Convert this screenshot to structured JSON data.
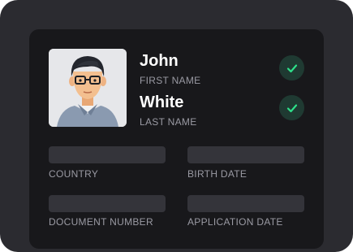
{
  "profile": {
    "first_name": "John",
    "first_name_label": "FIRST NAME",
    "last_name": "White",
    "last_name_label": "LAST NAME",
    "first_name_verified": true,
    "last_name_verified": true
  },
  "fields": {
    "country_label": "COUNTRY",
    "birth_date_label": "BIRTH DATE",
    "document_number_label": "DOCUMENT NUMBER",
    "application_date_label": "APPLICATION DATE"
  },
  "colors": {
    "card": "#18181b",
    "frame": "#2b2b30",
    "check_accent": "#2ee08a",
    "placeholder": "#34343a"
  },
  "icons": {
    "verified": "check-icon",
    "avatar": "user-avatar"
  }
}
